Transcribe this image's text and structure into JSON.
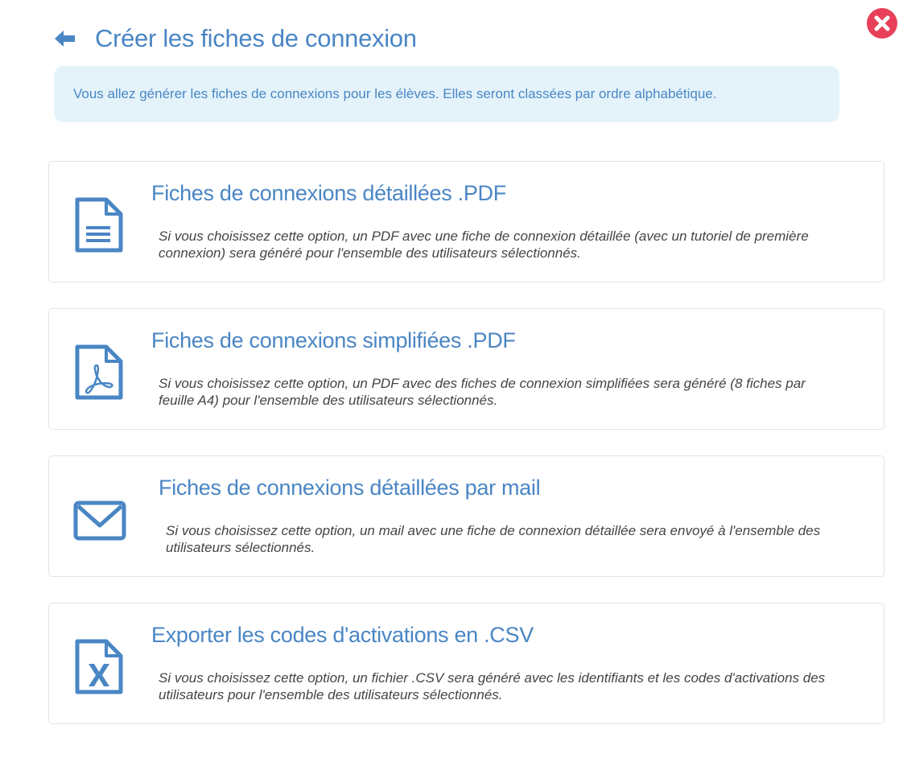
{
  "header": {
    "title": "Créer les fiches de connexion"
  },
  "info": {
    "message": "Vous allez générer les fiches de connexions pour les élèves. Elles seront classées par ordre alphabétique."
  },
  "options": [
    {
      "title": "Fiches de connexions détaillées .PDF",
      "description": "Si vous choisissez cette option, un PDF avec une fiche de connexion détaillée (avec un tutoriel de première connexion) sera généré pour l'ensemble des utilisateurs sélectionnés.",
      "icon": "document-lines-icon"
    },
    {
      "title": "Fiches de connexions simplifiées .PDF",
      "description": "Si vous choisissez cette option, un PDF avec des fiches de connexion simplifiées sera généré (8 fiches par feuille A4) pour l'ensemble des utilisateurs sélectionnés.",
      "icon": "pdf-file-icon"
    },
    {
      "title": "Fiches de connexions détaillées par mail",
      "description": "Si vous choisissez cette option, un mail avec une fiche de connexion détaillée sera envoyé à l'ensemble des utilisateurs sélectionnés.",
      "icon": "envelope-icon"
    },
    {
      "title": "Exporter les codes d'activations en .CSV",
      "description": "Si vous choisissez cette option, un fichier .CSV sera généré avec les identifiants et les codes d'activations des utilisateurs pour l'ensemble des utilisateurs sélectionnés.",
      "icon": "excel-file-icon"
    }
  ],
  "colors": {
    "accent": "#4a86c4",
    "info_background": "#e4f3fa",
    "close": "#e8405a",
    "description_text": "#444444",
    "card_border": "#e3e3e3"
  }
}
